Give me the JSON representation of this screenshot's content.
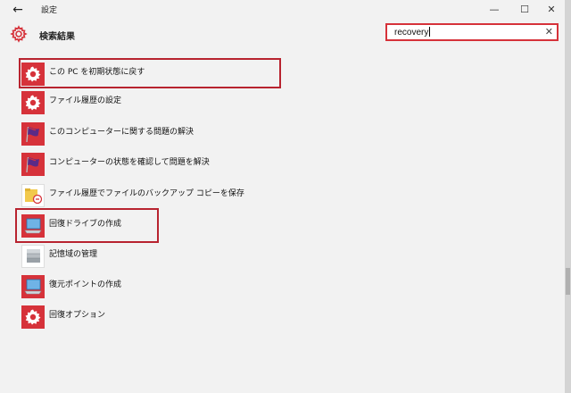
{
  "titlebar": {
    "back_glyph": "←",
    "title": "設定",
    "minimize_glyph": "—",
    "maximize_glyph": "☐",
    "close_glyph": "✕"
  },
  "header": {
    "title": "検索結果",
    "icon": "gear-icon"
  },
  "search": {
    "value": "recovery",
    "clear_glyph": "✕"
  },
  "colors": {
    "accent": "#d6323a",
    "highlight_border": "#b8232f",
    "background": "#f2f2f2"
  },
  "results": [
    {
      "label": "この PC を初期状態に戻す",
      "icon": "gear-icon",
      "highlighted": true
    },
    {
      "label": "ファイル履歴の設定",
      "icon": "gear-icon",
      "highlighted": false
    },
    {
      "label": "このコンピューターに関する問題の解決",
      "icon": "flag-icon",
      "highlighted": false
    },
    {
      "label": "コンピューターの状態を確認して問題を解決",
      "icon": "flag-icon",
      "highlighted": false
    },
    {
      "label": "ファイル履歴でファイルのバックアップ コピーを保存",
      "icon": "folder-icon",
      "highlighted": false
    },
    {
      "label": "回復ドライブの作成",
      "icon": "computer-icon",
      "highlighted": true
    },
    {
      "label": "記憶域の管理",
      "icon": "storage-icon",
      "highlighted": false
    },
    {
      "label": "復元ポイントの作成",
      "icon": "computer-icon",
      "highlighted": false
    },
    {
      "label": "回復オプション",
      "icon": "gear-icon",
      "highlighted": false
    }
  ]
}
